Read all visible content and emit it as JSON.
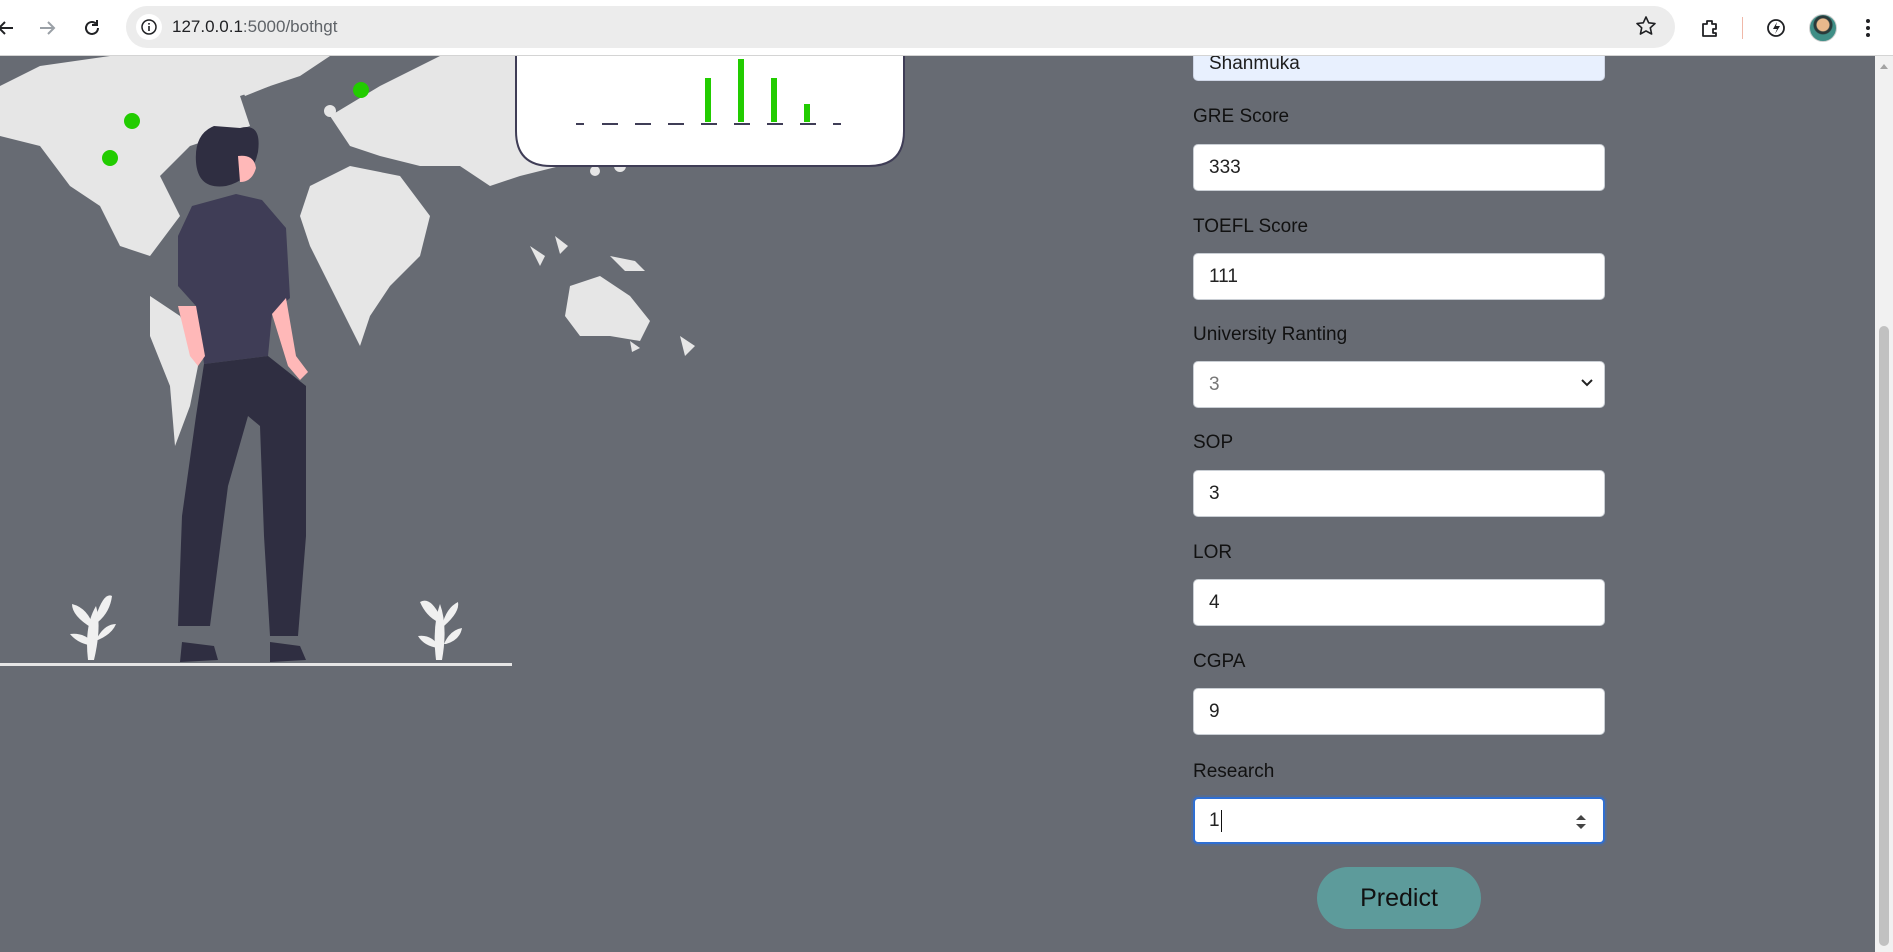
{
  "browser": {
    "url_host": "127.0.0.1",
    "url_path": ":5000/bothgt"
  },
  "form": {
    "name_value": "Shanmuka",
    "fields": [
      {
        "label": "GRE Score",
        "value": "333"
      },
      {
        "label": "TOEFL Score",
        "value": "111"
      },
      {
        "label": "University Ranting",
        "value": "3"
      },
      {
        "label": "SOP",
        "value": "3"
      },
      {
        "label": "LOR",
        "value": "4"
      },
      {
        "label": "CGPA",
        "value": "9"
      },
      {
        "label": "Research",
        "value": "1"
      }
    ],
    "submit_label": "Predict"
  },
  "colors": {
    "page_bg": "#676b73",
    "button_bg": "#5d9b9b",
    "accent_green": "#22cc00"
  }
}
